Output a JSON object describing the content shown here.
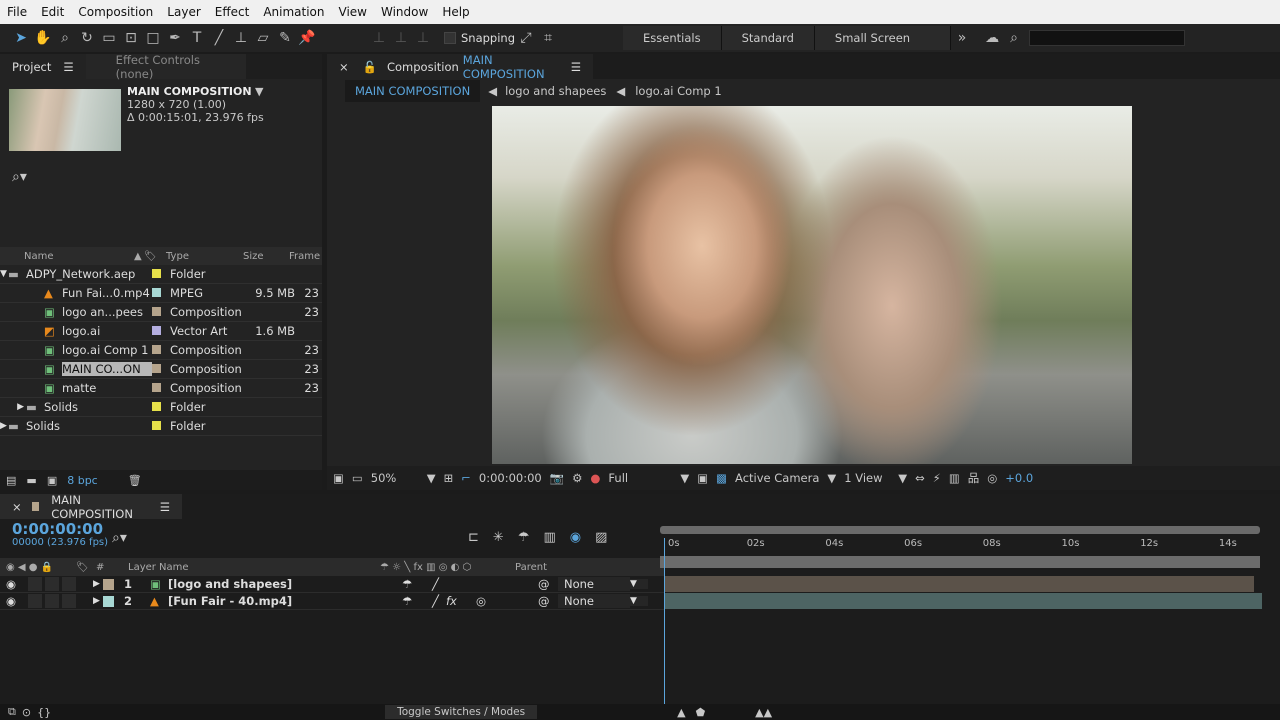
{
  "menu": [
    "File",
    "Edit",
    "Composition",
    "Layer",
    "Effect",
    "Animation",
    "View",
    "Window",
    "Help"
  ],
  "toolbar": {
    "snapping": "Snapping",
    "workspaces": [
      "Essentials",
      "Standard",
      "Small Screen"
    ],
    "search_placeholder": ""
  },
  "project": {
    "tab": "Project",
    "tab2": "Effect Controls (none)",
    "comp_name": "MAIN COMPOSITION",
    "comp_size": "1280 x 720 (1.00)",
    "comp_duration": "Δ 0:00:15:01, 23.976 fps",
    "columns": {
      "name": "Name",
      "type": "Type",
      "size": "Size",
      "frame": "Frame"
    },
    "items": [
      {
        "name": "ADPY_Network.aep",
        "type": "Folder",
        "size": "",
        "frame": "",
        "color": "#e6e04a",
        "icon": "folder",
        "indent": 0,
        "expand": "▼"
      },
      {
        "name": "Fun Fai...0.mp4",
        "type": "MPEG",
        "size": "9.5 MB",
        "frame": "23",
        "color": "#a8d8d4",
        "icon": "vlc",
        "indent": 2,
        "expand": ""
      },
      {
        "name": "logo an...pees",
        "type": "Composition",
        "size": "",
        "frame": "23",
        "color": "#b5a48c",
        "icon": "comp",
        "indent": 2,
        "expand": ""
      },
      {
        "name": "logo.ai",
        "type": "Vector Art",
        "size": "1.6 MB",
        "frame": "",
        "color": "#b4aee0",
        "icon": "ai",
        "indent": 2,
        "expand": ""
      },
      {
        "name": "logo.ai Comp 1",
        "type": "Composition",
        "size": "",
        "frame": "23",
        "color": "#b5a48c",
        "icon": "comp",
        "indent": 2,
        "expand": ""
      },
      {
        "name": "MAIN CO...ON",
        "type": "Composition",
        "size": "",
        "frame": "23",
        "color": "#b5a48c",
        "icon": "comp",
        "indent": 2,
        "expand": "",
        "selected": true
      },
      {
        "name": "matte",
        "type": "Composition",
        "size": "",
        "frame": "23",
        "color": "#b5a48c",
        "icon": "comp",
        "indent": 2,
        "expand": ""
      },
      {
        "name": "Solids",
        "type": "Folder",
        "size": "",
        "frame": "",
        "color": "#e6e04a",
        "icon": "folder",
        "indent": 1,
        "expand": "▶"
      },
      {
        "name": "Solids",
        "type": "Folder",
        "size": "",
        "frame": "",
        "color": "#e6e04a",
        "icon": "folder",
        "indent": 0,
        "expand": "▶"
      }
    ],
    "bpc": "8 bpc"
  },
  "composition": {
    "tab_prefix": "Composition",
    "tab_name": "MAIN COMPOSITION",
    "breadcrumbs": [
      "MAIN COMPOSITION",
      "logo and shapees",
      "logo.ai Comp 1"
    ],
    "zoom": "50%",
    "timecode": "0:00:00:00",
    "resolution": "Full",
    "camera": "Active Camera",
    "views": "1 View",
    "exposure": "+0.0"
  },
  "timeline": {
    "tab": "MAIN COMPOSITION",
    "timecode": "0:00:00:00",
    "frames": "00000 (23.976 fps)",
    "columns": {
      "num": "#",
      "layer_name": "Layer Name",
      "parent": "Parent"
    },
    "ruler": [
      "0s",
      "02s",
      "04s",
      "06s",
      "08s",
      "10s",
      "12s",
      "14s"
    ],
    "layers": [
      {
        "num": "1",
        "name": "[logo and shapees]",
        "color": "#b5a48c",
        "icon": "comp",
        "parent": "None",
        "fx": false
      },
      {
        "num": "2",
        "name": "[Fun Fair - 40.mp4]",
        "color": "#a8d8d4",
        "icon": "vlc",
        "parent": "None",
        "fx": true
      }
    ],
    "toggle": "Toggle Switches / Modes"
  },
  "colors": {
    "accent": "#5ba5dc",
    "panel": "#232323"
  }
}
